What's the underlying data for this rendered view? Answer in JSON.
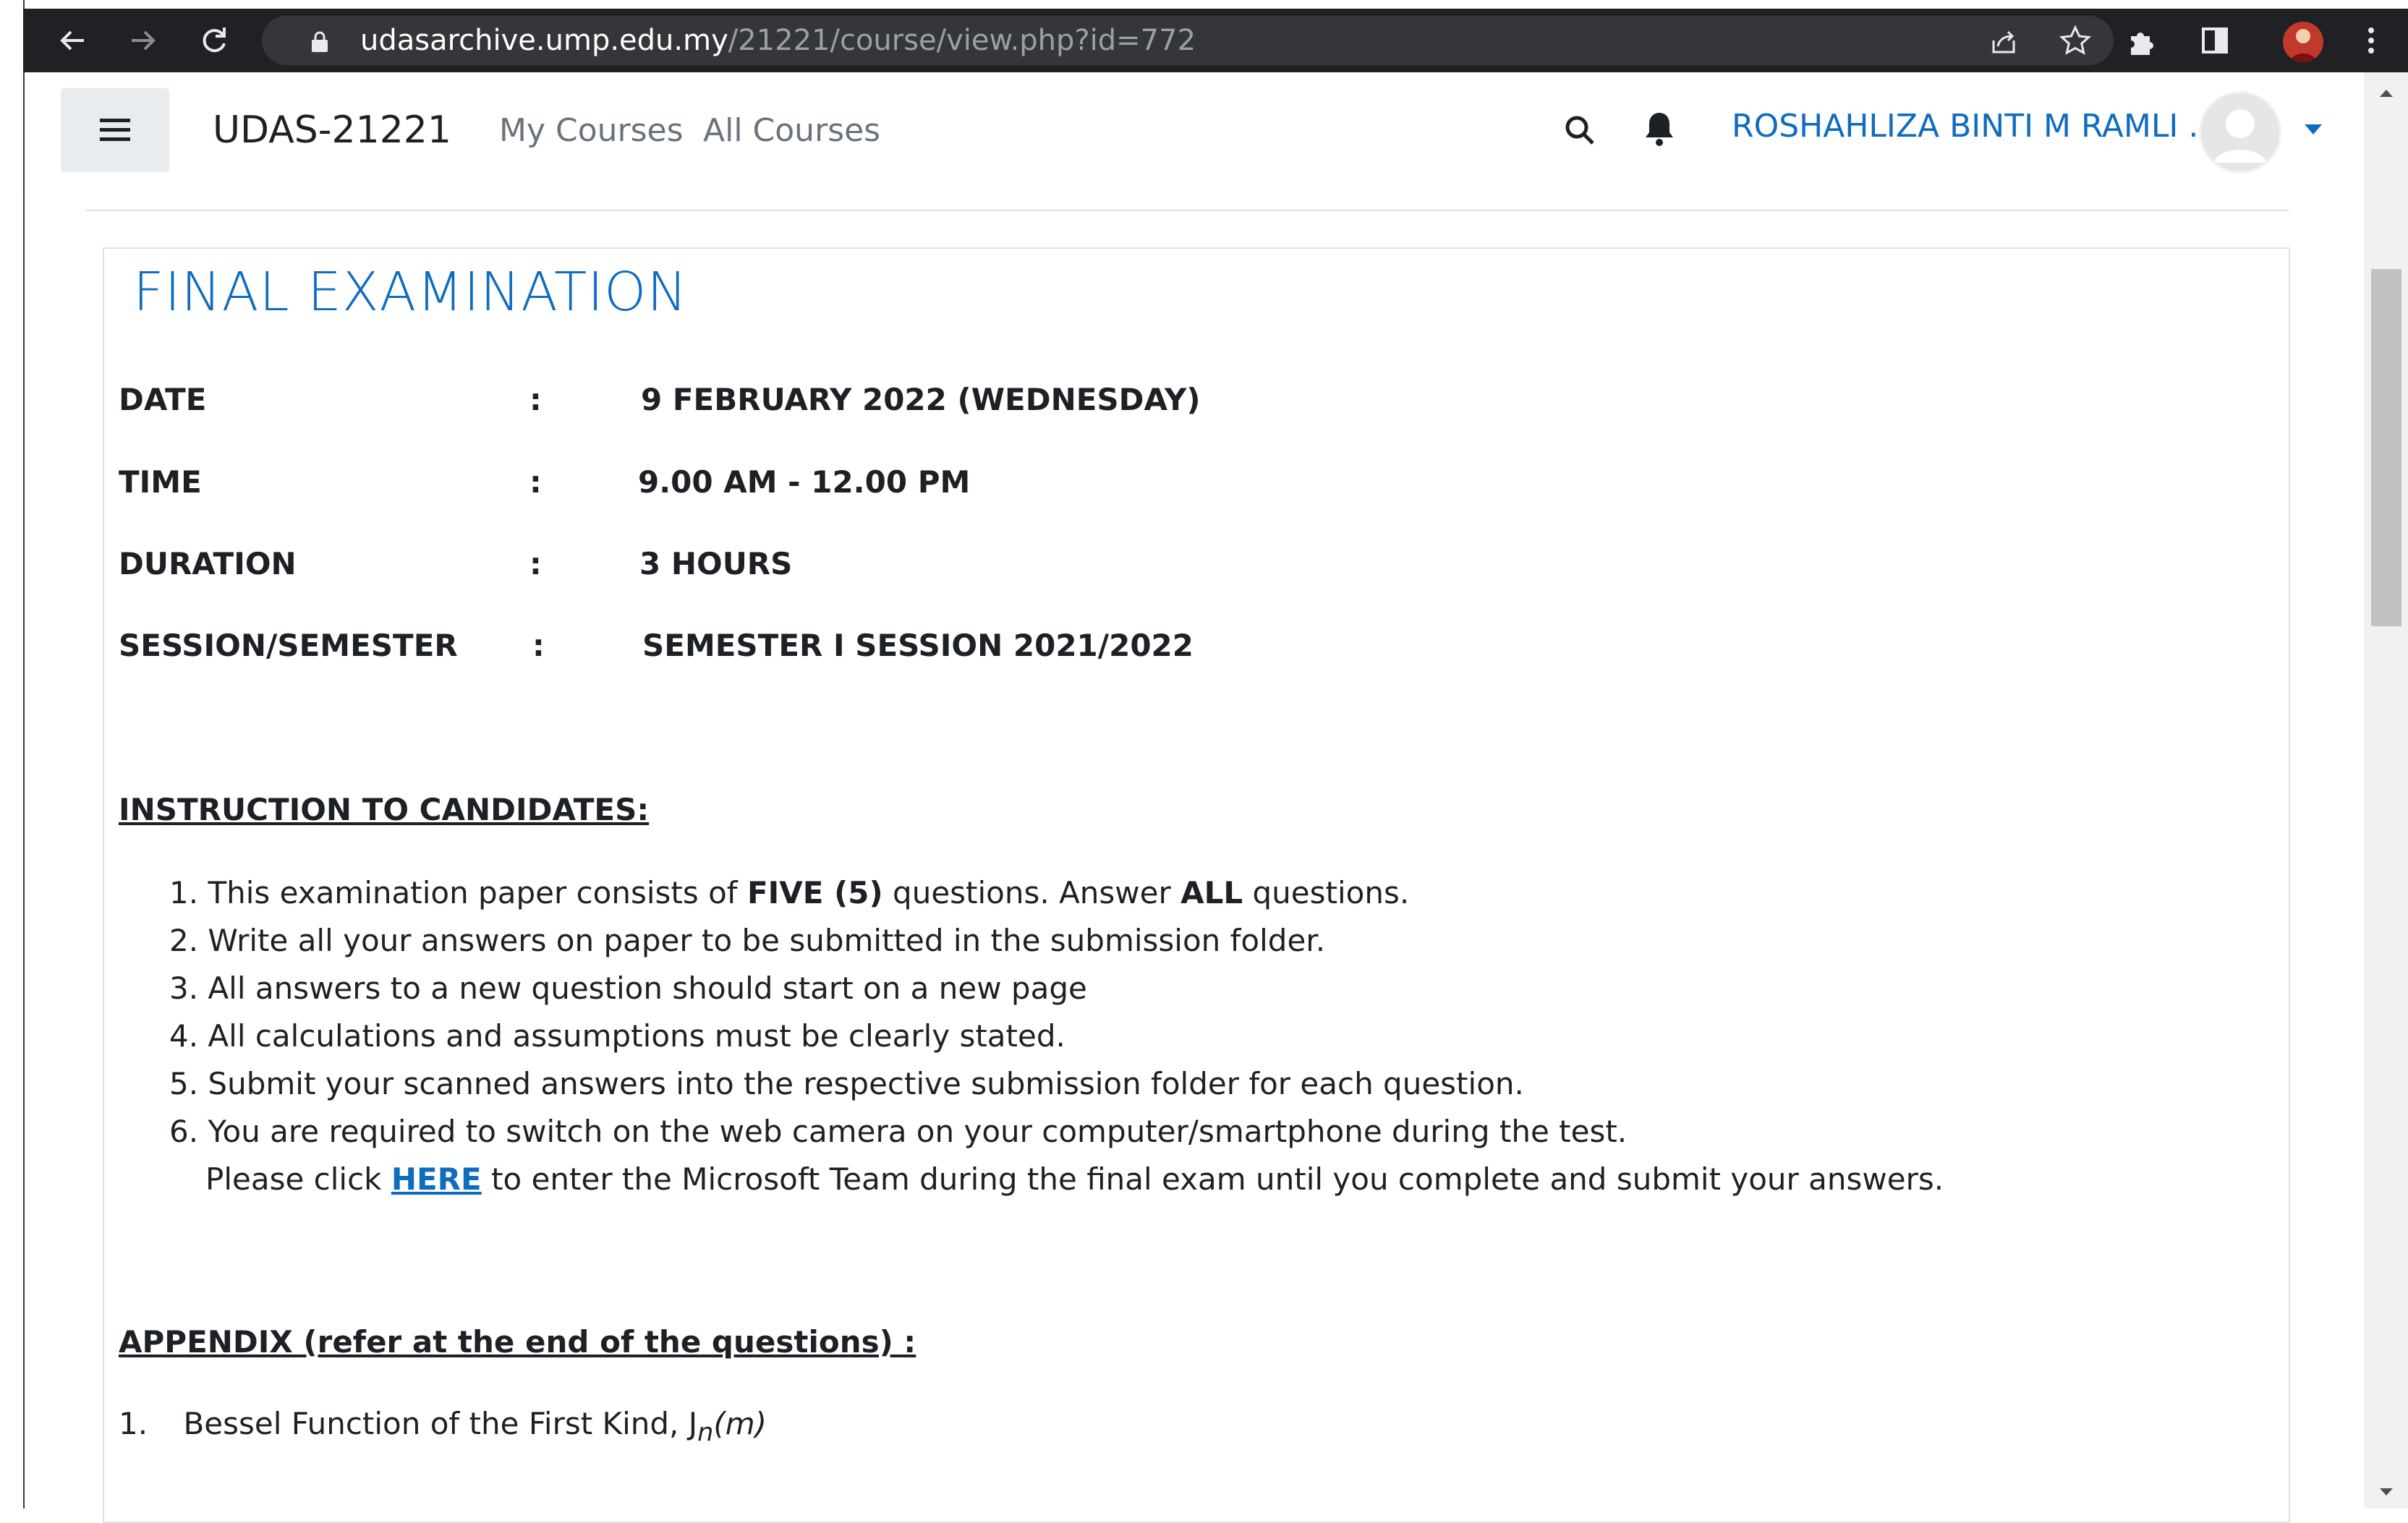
{
  "browser": {
    "url_host": "udasarchive.ump.edu.my",
    "url_path": "/21221/course/view.php?id=772"
  },
  "navbar": {
    "site_name": "UDAS-21221",
    "links": [
      "My Courses",
      "All Courses"
    ],
    "user_name": "ROSHAHLIZA BINTI M RAMLI ."
  },
  "section": {
    "title": "FINAL EXAMINATION",
    "info": [
      {
        "label": "DATE",
        "colon": ":",
        "value": "9 FEBRUARY 2022 (WEDNESDAY)"
      },
      {
        "label": "TIME",
        "colon": ":",
        "value": "9.00 AM - 12.00 PM"
      },
      {
        "label": "DURATION",
        "colon": ":",
        "value": "3 HOURS"
      },
      {
        "label": "SESSION/SEMESTER",
        "colon": ":",
        "value": "SEMESTER I SESSION 2021/2022"
      }
    ],
    "instruction_heading": "INSTRUCTION TO CANDIDATES:",
    "instructions": {
      "i1_num": "1.",
      "i1_a": "This examination paper consists of ",
      "i1_b": "FIVE (5)",
      "i1_c": " questions. Answer ",
      "i1_d": "ALL",
      "i1_e": " questions.",
      "i2": "2. Write all your answers on paper to be submitted in the submission folder.",
      "i3": "3. All answers to a new question should start on a new page",
      "i4": "4. All calculations and assumptions must be clearly stated.",
      "i5": "5. Submit your scanned answers into the respective submission folder for each question.",
      "i6": "6. You are required to switch on the web camera on your computer/smartphone during the test.",
      "i6_cont_a": "Please click ",
      "i6_link": "HERE",
      "i6_cont_b": " to enter the Microsoft Team during the final exam until you complete and submit your answers."
    },
    "appendix_heading": "APPENDIX (refer at the end of the questions) :",
    "appendix_items": [
      {
        "num": "1.",
        "text": "Bessel Function of the First Kind, J",
        "sub": "n",
        "arg": "(m)"
      }
    ]
  }
}
